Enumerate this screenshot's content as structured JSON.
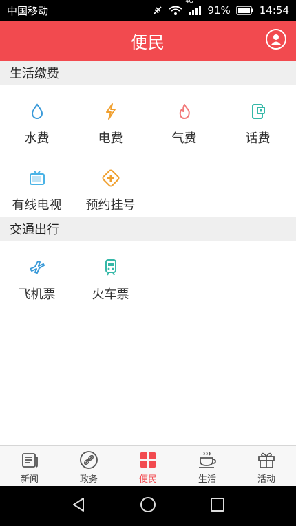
{
  "status_bar": {
    "carrier": "中国移动",
    "network": "4G",
    "battery": "91%",
    "time": "14:54"
  },
  "header": {
    "title": "便民"
  },
  "sections": [
    {
      "title": "生活缴费",
      "items": [
        {
          "label": "水费",
          "icon": "water-drop-icon",
          "color": "#3a9ad9"
        },
        {
          "label": "电费",
          "icon": "lightning-icon",
          "color": "#f0a030"
        },
        {
          "label": "气费",
          "icon": "flame-icon",
          "color": "#f27a7a"
        },
        {
          "label": "话费",
          "icon": "phone-bill-icon",
          "color": "#35b8a8"
        },
        {
          "label": "有线电视",
          "icon": "tv-icon",
          "color": "#4ab3e6"
        },
        {
          "label": "预约挂号",
          "icon": "medical-cross-icon",
          "color": "#f0a030"
        }
      ]
    },
    {
      "title": "交通出行",
      "items": [
        {
          "label": "飞机票",
          "icon": "airplane-icon",
          "color": "#3a9ad9"
        },
        {
          "label": "火车票",
          "icon": "train-icon",
          "color": "#35b8a8"
        }
      ]
    }
  ],
  "bottom_nav": [
    {
      "label": "新闻",
      "icon": "news-icon",
      "active": false
    },
    {
      "label": "政务",
      "icon": "government-icon",
      "active": false
    },
    {
      "label": "便民",
      "icon": "grid-icon",
      "active": true
    },
    {
      "label": "生活",
      "icon": "coffee-icon",
      "active": false
    },
    {
      "label": "活动",
      "icon": "gift-icon",
      "active": false
    }
  ],
  "colors": {
    "accent": "#f24a4f",
    "section_bg": "#efefef"
  }
}
